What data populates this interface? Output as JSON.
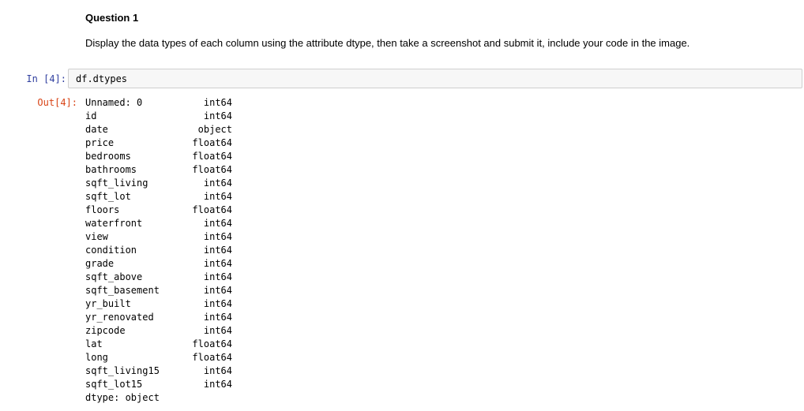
{
  "markdown": {
    "heading": "Question 1",
    "instruction": "Display the data types of each column using the attribute dtype, then take a screenshot and submit it, include your code in the image."
  },
  "input_cell": {
    "prompt_prefix": "In [4]:",
    "code": "df.dtypes"
  },
  "output_cell": {
    "prompt_prefix": "Out[4]:",
    "rows": [
      {
        "column": "Unnamed: 0",
        "dtype": "int64"
      },
      {
        "column": "id",
        "dtype": "int64"
      },
      {
        "column": "date",
        "dtype": "object"
      },
      {
        "column": "price",
        "dtype": "float64"
      },
      {
        "column": "bedrooms",
        "dtype": "float64"
      },
      {
        "column": "bathrooms",
        "dtype": "float64"
      },
      {
        "column": "sqft_living",
        "dtype": "int64"
      },
      {
        "column": "sqft_lot",
        "dtype": "int64"
      },
      {
        "column": "floors",
        "dtype": "float64"
      },
      {
        "column": "waterfront",
        "dtype": "int64"
      },
      {
        "column": "view",
        "dtype": "int64"
      },
      {
        "column": "condition",
        "dtype": "int64"
      },
      {
        "column": "grade",
        "dtype": "int64"
      },
      {
        "column": "sqft_above",
        "dtype": "int64"
      },
      {
        "column": "sqft_basement",
        "dtype": "int64"
      },
      {
        "column": "yr_built",
        "dtype": "int64"
      },
      {
        "column": "yr_renovated",
        "dtype": "int64"
      },
      {
        "column": "zipcode",
        "dtype": "int64"
      },
      {
        "column": "lat",
        "dtype": "float64"
      },
      {
        "column": "long",
        "dtype": "float64"
      },
      {
        "column": "sqft_living15",
        "dtype": "int64"
      },
      {
        "column": "sqft_lot15",
        "dtype": "int64"
      }
    ],
    "footer": "dtype: object"
  },
  "colors": {
    "in_prompt": "#303f9f",
    "out_prompt": "#d84315",
    "input_bg": "#f7f7f7",
    "input_border": "#cfcfcf"
  }
}
